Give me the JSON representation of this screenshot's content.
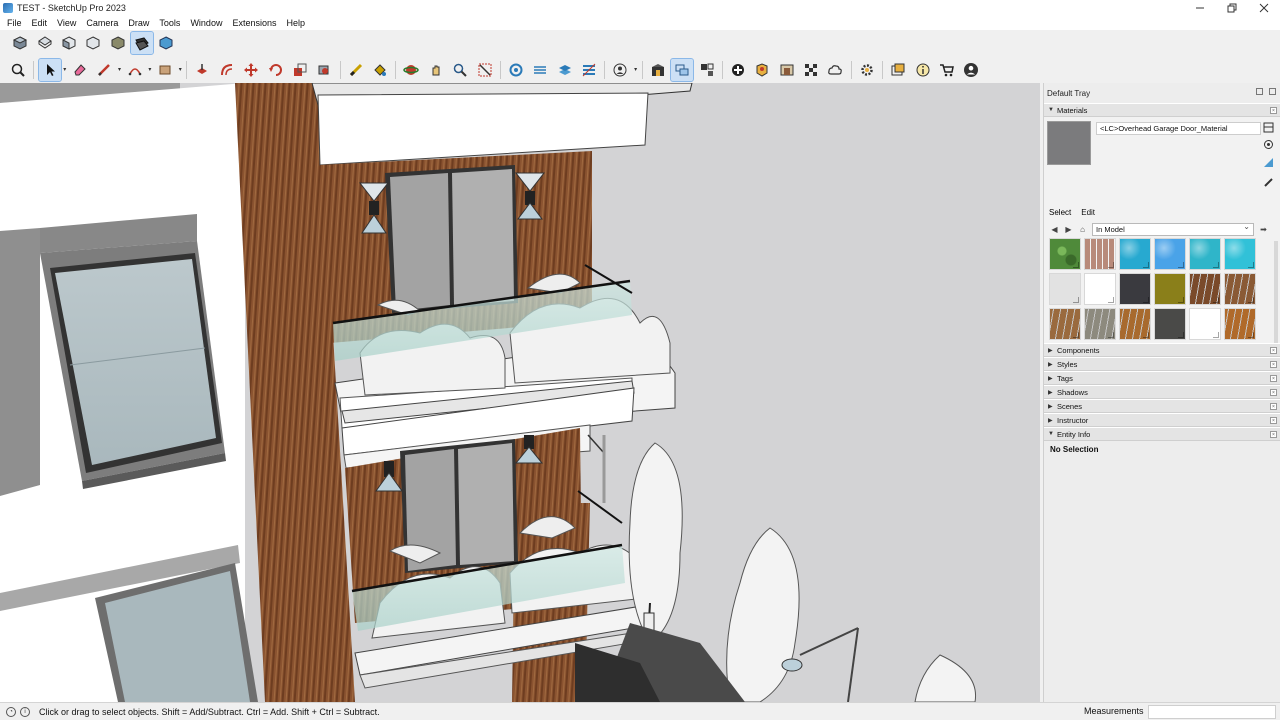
{
  "window": {
    "title": "TEST - SketchUp Pro 2023",
    "controls": [
      "minimize",
      "restore",
      "close"
    ]
  },
  "menubar": {
    "items": [
      "File",
      "Edit",
      "View",
      "Camera",
      "Draw",
      "Tools",
      "Window",
      "Extensions",
      "Help"
    ]
  },
  "toolbar1": {
    "icons": [
      "iso-view-icon",
      "top-view-icon",
      "front-view-icon",
      "right-view-icon",
      "back-view-icon",
      "left-view-icon",
      "bottom-view-icon"
    ]
  },
  "toolbar2": {
    "icons": [
      "zoom-extents-icon",
      "select-icon",
      "eraser-icon",
      "pencil-line-icon",
      "arc-icon",
      "rectangle-icon",
      "push-pull-icon",
      "offset-icon",
      "move-icon",
      "rotate-icon",
      "scale-icon",
      "follow-me-icon",
      "tape-measure-icon",
      "paint-bucket-icon",
      "orbit-icon",
      "pan-icon",
      "zoom-icon",
      "zoom-window-icon",
      "section-plane-icon",
      "display-section-planes-icon",
      "section-cuts-icon",
      "section-fill-icon",
      "profile-icon",
      "warehouse-icon",
      "outliner-icon",
      "components-icon",
      "add-location-icon",
      "geo-icon",
      "3d-warehouse-icon",
      "extension-warehouse-icon",
      "checker-icon",
      "cloud-icon",
      "settings-icon",
      "layout-icon",
      "info-icon",
      "cart-icon",
      "account-icon"
    ]
  },
  "tray": {
    "title": "Default Tray",
    "materials": {
      "panel_label": "Materials",
      "current_material": "<LC>Overhead Garage Door_Material",
      "current_color": "#7b7b7d",
      "tabs": [
        "Select",
        "Edit"
      ],
      "collection": "In Model",
      "swatches": [
        {
          "color": "#4f8a3a",
          "pattern": "foliage"
        },
        {
          "color": "#b88a7a",
          "pattern": "stone"
        },
        {
          "color": "#27a9d0",
          "pattern": "water"
        },
        {
          "color": "#4aa3e8",
          "pattern": "water"
        },
        {
          "color": "#2fb5c9",
          "pattern": "water"
        },
        {
          "color": "#31c1d8",
          "pattern": "water"
        },
        {
          "color": "#e2e2e2",
          "pattern": "flat"
        },
        {
          "color": "#ffffff",
          "pattern": "flat"
        },
        {
          "color": "#3a3a3f",
          "pattern": "flat"
        },
        {
          "color": "#8a7f1a",
          "pattern": "flat"
        },
        {
          "color": "#7a4a2a",
          "pattern": "wood"
        },
        {
          "color": "#8a5a35",
          "pattern": "wood"
        },
        {
          "color": "#9a6a3e",
          "pattern": "wood"
        },
        {
          "color": "#8d8a7e",
          "pattern": "wood"
        },
        {
          "color": "#a86a2e",
          "pattern": "wood"
        },
        {
          "color": "#4a4a48",
          "pattern": "flat"
        },
        {
          "color": "#ffffff",
          "pattern": "flat"
        },
        {
          "color": "#b06a2a",
          "pattern": "wood"
        },
        {
          "color": "#5a4a3e",
          "pattern": "wood"
        },
        {
          "color": "#3c3e38",
          "pattern": "wood"
        },
        {
          "color": "#8a3a14",
          "pattern": "wood"
        },
        {
          "color": "#6a5444",
          "pattern": "stone"
        }
      ]
    },
    "panels": [
      "Components",
      "Styles",
      "Tags",
      "Shadows",
      "Scenes",
      "Instructor"
    ],
    "entity_info": {
      "label": "Entity Info",
      "selection": "No Selection"
    }
  },
  "statusbar": {
    "message": "Click or drag to select objects. Shift = Add/Subtract. Ctrl = Add. Shift + Ctrl = Subtract.",
    "measurements_label": "Measurements",
    "measurements_value": ""
  }
}
